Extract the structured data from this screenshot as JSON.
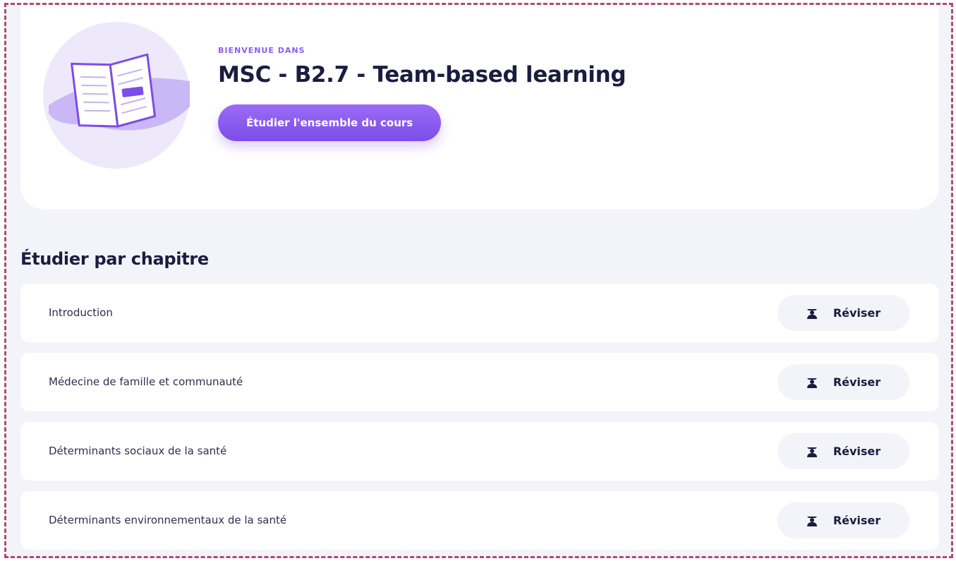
{
  "hero": {
    "eyebrow": "BIENVENUE DANS",
    "title": "MSC - B2.7 - Team-based learning",
    "study_all_label": "Étudier l'ensemble du cours",
    "illustration": "open-book-icon"
  },
  "section": {
    "title": "Étudier par chapitre"
  },
  "chapters": [
    {
      "title": "Introduction",
      "action_label": "Réviser",
      "action_icon": "student-icon"
    },
    {
      "title": "Médecine de famille et communauté",
      "action_label": "Réviser",
      "action_icon": "student-icon"
    },
    {
      "title": "Déterminants sociaux de la santé",
      "action_label": "Réviser",
      "action_icon": "student-icon"
    },
    {
      "title": "Déterminants environnementaux de la santé",
      "action_label": "Réviser",
      "action_icon": "student-icon"
    }
  ],
  "colors": {
    "accent": "#8b5cf6",
    "accent_dark": "#7c4de8",
    "text": "#1b1d3f",
    "background": "#f3f4f9",
    "card": "#ffffff",
    "frame_border": "#b24a6e"
  }
}
